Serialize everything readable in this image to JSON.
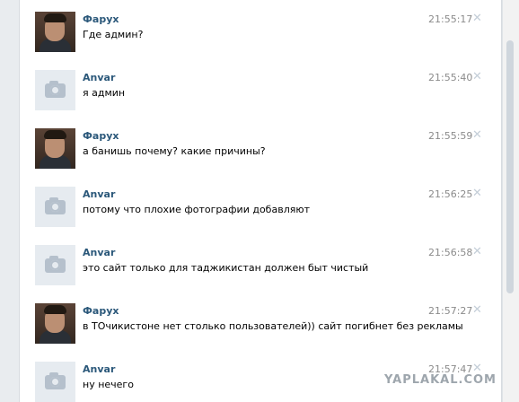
{
  "messages": [
    {
      "author": "Фарух",
      "avatar": "user-photo",
      "text": "Где админ?",
      "time": "21:55:17",
      "delete_icon": "close-icon"
    },
    {
      "author": "Anvar",
      "avatar": "camera-placeholder",
      "text": "я админ",
      "time": "21:55:40",
      "delete_icon": "close-icon"
    },
    {
      "author": "Фарух",
      "avatar": "user-photo",
      "text": "а банишь почему? какие причины?",
      "time": "21:55:59",
      "delete_icon": "close-icon"
    },
    {
      "author": "Anvar",
      "avatar": "camera-placeholder",
      "text": "потому что плохие фотографии добавляют",
      "time": "21:56:25",
      "delete_icon": "close-icon"
    },
    {
      "author": "Anvar",
      "avatar": "camera-placeholder",
      "text": "это сайт только для таджикистан должен быт чистый",
      "time": "21:56:58",
      "delete_icon": "close-icon"
    },
    {
      "author": "Фарух",
      "avatar": "user-photo",
      "text": "в ТОчикистоне нет столько пользователей)) сайт погибнет без рекламы",
      "time": "21:57:27",
      "delete_icon": "close-icon"
    },
    {
      "author": "Anvar",
      "avatar": "camera-placeholder",
      "text": "ну нечего",
      "time": "21:57:47",
      "delete_icon": "close-icon"
    }
  ],
  "watermark": "YAPLAKAL.COM",
  "colors": {
    "author": "#2b587a",
    "time": "#8b8b8b",
    "delete": "#c4ced8",
    "background": "#ffffff"
  }
}
